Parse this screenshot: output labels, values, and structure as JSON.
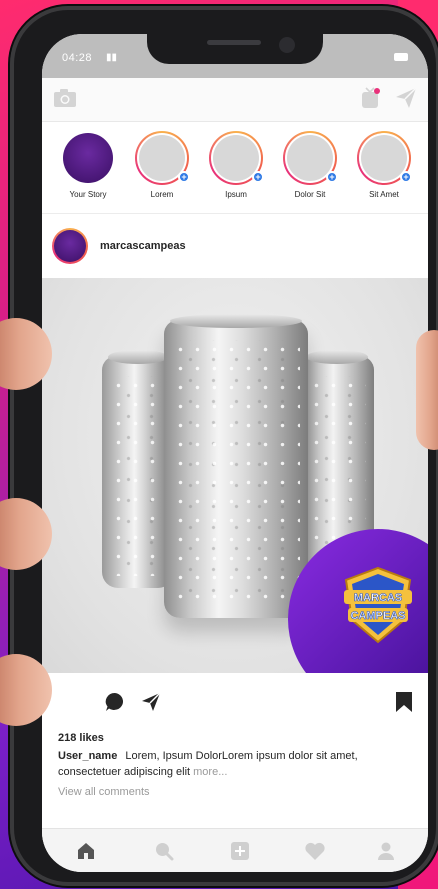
{
  "status_bar": {
    "time": "04:28"
  },
  "stories": [
    {
      "label": "Your Story",
      "own": true
    },
    {
      "label": "Lorem"
    },
    {
      "label": "Ipsum"
    },
    {
      "label": "Dolor Sit"
    },
    {
      "label": "Sit Amet"
    }
  ],
  "post": {
    "username": "marcascampeas",
    "promo_logo_text": [
      "MARCAS",
      "CAMPEAS"
    ],
    "likes": "218 likes",
    "caption_user": "User_name",
    "caption_text": "Lorem, Ipsum DolorLorem ipsum dolor sit amet, consectetuer adipiscing elit",
    "more_label": "more...",
    "view_comments": "View all comments"
  },
  "icons": {
    "top_left": "camera-icon",
    "top_right": [
      "igtv-icon",
      "direct-send-icon"
    ],
    "actions": [
      "comment-icon",
      "share-icon",
      "bookmark-icon"
    ],
    "tabbar": [
      "home-icon",
      "search-icon",
      "add-post-icon",
      "heart-icon",
      "profile-icon"
    ]
  },
  "colors": {
    "accent_blue": "#2f7ae5",
    "brand_purple": "#5a1ab0",
    "background_pink": "#ff2b6e"
  }
}
